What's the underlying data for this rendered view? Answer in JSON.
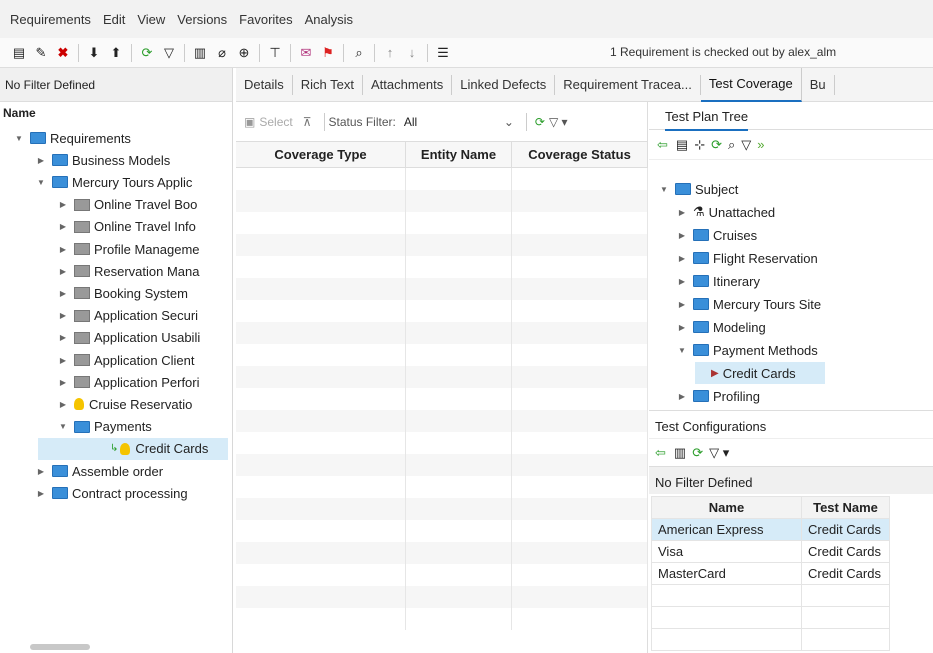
{
  "menu": [
    "Requirements",
    "Edit",
    "View",
    "Versions",
    "Favorites",
    "Analysis"
  ],
  "status_text": "1 Requirement is checked out by alex_alm",
  "left": {
    "filter": "No Filter Defined",
    "name_header": "Name",
    "tree": [
      {
        "label": "Requirements",
        "level": 0,
        "icon": "folder-open",
        "arrow": "down"
      },
      {
        "label": "Business Models",
        "level": 1,
        "icon": "folder",
        "arrow": "right"
      },
      {
        "label": "Mercury Tours Applic",
        "level": 1,
        "icon": "folder-open",
        "arrow": "down"
      },
      {
        "label": "Online Travel Boo",
        "level": 2,
        "icon": "gray-folder",
        "arrow": "right"
      },
      {
        "label": "Online Travel Info",
        "level": 2,
        "icon": "gray-folder",
        "arrow": "right"
      },
      {
        "label": "Profile Manageme",
        "level": 2,
        "icon": "gray-folder",
        "arrow": "right"
      },
      {
        "label": "Reservation Mana",
        "level": 2,
        "icon": "gray-folder",
        "arrow": "right"
      },
      {
        "label": "Booking System",
        "level": 2,
        "icon": "gray-folder",
        "arrow": "right"
      },
      {
        "label": "Application Securi",
        "level": 2,
        "icon": "gray-folder",
        "arrow": "right"
      },
      {
        "label": "Application Usabili",
        "level": 2,
        "icon": "gray-folder",
        "arrow": "right"
      },
      {
        "label": "Application Client",
        "level": 2,
        "icon": "gray-folder",
        "arrow": "right"
      },
      {
        "label": "Application Perfori",
        "level": 2,
        "icon": "gray-folder",
        "arrow": "right"
      },
      {
        "label": "Cruise Reservatio",
        "level": 2,
        "icon": "bulb",
        "arrow": "right"
      },
      {
        "label": "Payments",
        "level": 2,
        "icon": "folder-open",
        "arrow": "down"
      },
      {
        "label": "Credit Cards",
        "level": 3,
        "icon": "bulb",
        "arrow": "",
        "selected": true
      },
      {
        "label": "Assemble order",
        "level": 1,
        "icon": "folder",
        "arrow": "right"
      },
      {
        "label": "Contract processing",
        "level": 1,
        "icon": "folder",
        "arrow": "right"
      }
    ]
  },
  "tabs": [
    "Details",
    "Rich Text",
    "Attachments",
    "Linked Defects",
    "Requirement Tracea...",
    "Test Coverage",
    "Bu"
  ],
  "middle": {
    "select_label": "Select",
    "status_filter_label": "Status Filter:",
    "status_filter_value": "All",
    "columns": [
      "Coverage Type",
      "Entity Name",
      "Coverage Status"
    ]
  },
  "right": {
    "tab": "Test Plan Tree",
    "tree": [
      {
        "label": "Subject",
        "level": 0,
        "arrow": "down",
        "icon": "folder-open"
      },
      {
        "label": "Unattached",
        "level": 1,
        "arrow": "right",
        "icon": "flask"
      },
      {
        "label": "Cruises",
        "level": 1,
        "arrow": "right",
        "icon": "folder"
      },
      {
        "label": "Flight Reservation",
        "level": 1,
        "arrow": "right",
        "icon": "folder"
      },
      {
        "label": "Itinerary",
        "level": 1,
        "arrow": "right",
        "icon": "folder"
      },
      {
        "label": "Mercury Tours Site",
        "level": 1,
        "arrow": "right",
        "icon": "folder"
      },
      {
        "label": "Modeling",
        "level": 1,
        "arrow": "right",
        "icon": "folder"
      },
      {
        "label": "Payment Methods",
        "level": 1,
        "arrow": "down",
        "icon": "folder-open"
      },
      {
        "label": "Credit Cards",
        "level": 2,
        "arrow": "",
        "icon": "test",
        "selected": true
      },
      {
        "label": "Profiling",
        "level": 1,
        "arrow": "right",
        "icon": "folder"
      }
    ],
    "test_configurations": "Test Configurations",
    "cfg_filter": "No Filter Defined",
    "cfg_columns": [
      "Name",
      "Test Name"
    ],
    "cfg_rows": [
      [
        "American Express",
        "Credit Cards"
      ],
      [
        "Visa",
        "Credit Cards"
      ],
      [
        "MasterCard",
        "Credit Cards"
      ]
    ]
  }
}
